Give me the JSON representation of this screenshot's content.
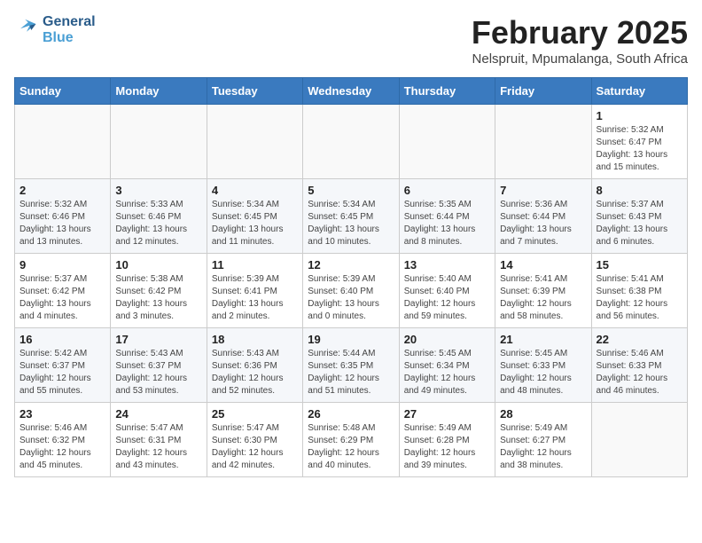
{
  "header": {
    "logo_line1": "General",
    "logo_line2": "Blue",
    "month_title": "February 2025",
    "location": "Nelspruit, Mpumalanga, South Africa"
  },
  "weekdays": [
    "Sunday",
    "Monday",
    "Tuesday",
    "Wednesday",
    "Thursday",
    "Friday",
    "Saturday"
  ],
  "weeks": [
    [
      {
        "day": "",
        "info": ""
      },
      {
        "day": "",
        "info": ""
      },
      {
        "day": "",
        "info": ""
      },
      {
        "day": "",
        "info": ""
      },
      {
        "day": "",
        "info": ""
      },
      {
        "day": "",
        "info": ""
      },
      {
        "day": "1",
        "info": "Sunrise: 5:32 AM\nSunset: 6:47 PM\nDaylight: 13 hours\nand 15 minutes."
      }
    ],
    [
      {
        "day": "2",
        "info": "Sunrise: 5:32 AM\nSunset: 6:46 PM\nDaylight: 13 hours\nand 13 minutes."
      },
      {
        "day": "3",
        "info": "Sunrise: 5:33 AM\nSunset: 6:46 PM\nDaylight: 13 hours\nand 12 minutes."
      },
      {
        "day": "4",
        "info": "Sunrise: 5:34 AM\nSunset: 6:45 PM\nDaylight: 13 hours\nand 11 minutes."
      },
      {
        "day": "5",
        "info": "Sunrise: 5:34 AM\nSunset: 6:45 PM\nDaylight: 13 hours\nand 10 minutes."
      },
      {
        "day": "6",
        "info": "Sunrise: 5:35 AM\nSunset: 6:44 PM\nDaylight: 13 hours\nand 8 minutes."
      },
      {
        "day": "7",
        "info": "Sunrise: 5:36 AM\nSunset: 6:44 PM\nDaylight: 13 hours\nand 7 minutes."
      },
      {
        "day": "8",
        "info": "Sunrise: 5:37 AM\nSunset: 6:43 PM\nDaylight: 13 hours\nand 6 minutes."
      }
    ],
    [
      {
        "day": "9",
        "info": "Sunrise: 5:37 AM\nSunset: 6:42 PM\nDaylight: 13 hours\nand 4 minutes."
      },
      {
        "day": "10",
        "info": "Sunrise: 5:38 AM\nSunset: 6:42 PM\nDaylight: 13 hours\nand 3 minutes."
      },
      {
        "day": "11",
        "info": "Sunrise: 5:39 AM\nSunset: 6:41 PM\nDaylight: 13 hours\nand 2 minutes."
      },
      {
        "day": "12",
        "info": "Sunrise: 5:39 AM\nSunset: 6:40 PM\nDaylight: 13 hours\nand 0 minutes."
      },
      {
        "day": "13",
        "info": "Sunrise: 5:40 AM\nSunset: 6:40 PM\nDaylight: 12 hours\nand 59 minutes."
      },
      {
        "day": "14",
        "info": "Sunrise: 5:41 AM\nSunset: 6:39 PM\nDaylight: 12 hours\nand 58 minutes."
      },
      {
        "day": "15",
        "info": "Sunrise: 5:41 AM\nSunset: 6:38 PM\nDaylight: 12 hours\nand 56 minutes."
      }
    ],
    [
      {
        "day": "16",
        "info": "Sunrise: 5:42 AM\nSunset: 6:37 PM\nDaylight: 12 hours\nand 55 minutes."
      },
      {
        "day": "17",
        "info": "Sunrise: 5:43 AM\nSunset: 6:37 PM\nDaylight: 12 hours\nand 53 minutes."
      },
      {
        "day": "18",
        "info": "Sunrise: 5:43 AM\nSunset: 6:36 PM\nDaylight: 12 hours\nand 52 minutes."
      },
      {
        "day": "19",
        "info": "Sunrise: 5:44 AM\nSunset: 6:35 PM\nDaylight: 12 hours\nand 51 minutes."
      },
      {
        "day": "20",
        "info": "Sunrise: 5:45 AM\nSunset: 6:34 PM\nDaylight: 12 hours\nand 49 minutes."
      },
      {
        "day": "21",
        "info": "Sunrise: 5:45 AM\nSunset: 6:33 PM\nDaylight: 12 hours\nand 48 minutes."
      },
      {
        "day": "22",
        "info": "Sunrise: 5:46 AM\nSunset: 6:33 PM\nDaylight: 12 hours\nand 46 minutes."
      }
    ],
    [
      {
        "day": "23",
        "info": "Sunrise: 5:46 AM\nSunset: 6:32 PM\nDaylight: 12 hours\nand 45 minutes."
      },
      {
        "day": "24",
        "info": "Sunrise: 5:47 AM\nSunset: 6:31 PM\nDaylight: 12 hours\nand 43 minutes."
      },
      {
        "day": "25",
        "info": "Sunrise: 5:47 AM\nSunset: 6:30 PM\nDaylight: 12 hours\nand 42 minutes."
      },
      {
        "day": "26",
        "info": "Sunrise: 5:48 AM\nSunset: 6:29 PM\nDaylight: 12 hours\nand 40 minutes."
      },
      {
        "day": "27",
        "info": "Sunrise: 5:49 AM\nSunset: 6:28 PM\nDaylight: 12 hours\nand 39 minutes."
      },
      {
        "day": "28",
        "info": "Sunrise: 5:49 AM\nSunset: 6:27 PM\nDaylight: 12 hours\nand 38 minutes."
      },
      {
        "day": "",
        "info": ""
      }
    ]
  ]
}
